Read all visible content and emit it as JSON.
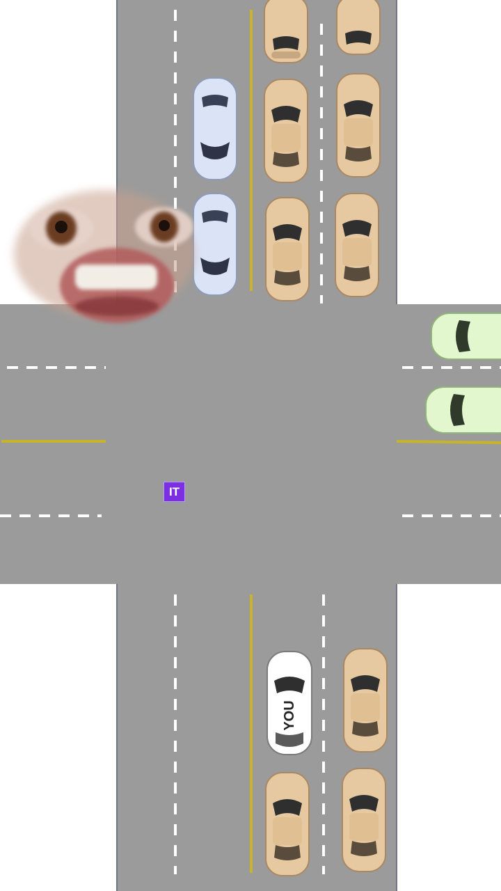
{
  "game": {
    "player_label": "YOU",
    "it_badge": "IT"
  },
  "colors": {
    "background": "#ffffff",
    "road": "#9b9b9b",
    "lane_dash": "#ffffff",
    "center_line": "#c8b42a",
    "tan_car": "#e6c9a0",
    "blue_car": "#dbe4f7",
    "green_car": "#e2f7cd",
    "player_car": "#ffffff",
    "badge": "#7b2fe0"
  },
  "icons": [
    "tan-car-icon",
    "blue-car-icon",
    "green-car-icon",
    "player-car-icon",
    "face-icon"
  ]
}
